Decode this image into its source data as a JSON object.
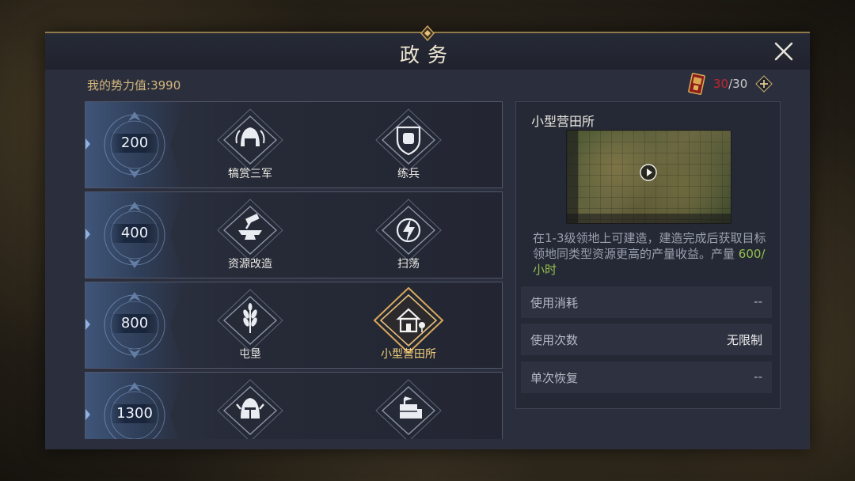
{
  "title": "政务",
  "power": {
    "label": "我的势力值:",
    "value": "3990"
  },
  "orders": {
    "current": "30",
    "separator": "/",
    "max": "30"
  },
  "tiers": [
    {
      "value": "200",
      "skills": [
        {
          "label": "犒赏三军",
          "icon": "helmet-laurel-icon"
        },
        {
          "label": "练兵",
          "icon": "fist-shield-icon"
        }
      ]
    },
    {
      "value": "400",
      "skills": [
        {
          "label": "资源改造",
          "icon": "anvil-hammer-icon"
        },
        {
          "label": "扫荡",
          "icon": "lightning-icon"
        }
      ]
    },
    {
      "value": "800",
      "skills": [
        {
          "label": "屯垦",
          "icon": "wheat-icon"
        },
        {
          "label": "小型营田所",
          "icon": "farmhouse-icon",
          "selected": true
        }
      ]
    },
    {
      "value": "1300",
      "skills": [
        {
          "label": "",
          "icon": "knight-helmet-icon"
        },
        {
          "label": "",
          "icon": "resource-crate-icon"
        }
      ]
    }
  ],
  "detail": {
    "title": "小型营田所",
    "description": "在1-3级领地上可建造，建造完成后获取目标领地同类型资源更高的产量收益。产量 ",
    "yield": "600/小时",
    "stats": [
      {
        "label": "使用消耗",
        "value": "--"
      },
      {
        "label": "使用次数",
        "value": "无限制"
      },
      {
        "label": "单次恢复",
        "value": "--"
      }
    ]
  },
  "colors": {
    "gold": "#d3b67c",
    "selected": "#f3cf7d",
    "yield": "#93c04d",
    "order_current": "#c0262b"
  }
}
